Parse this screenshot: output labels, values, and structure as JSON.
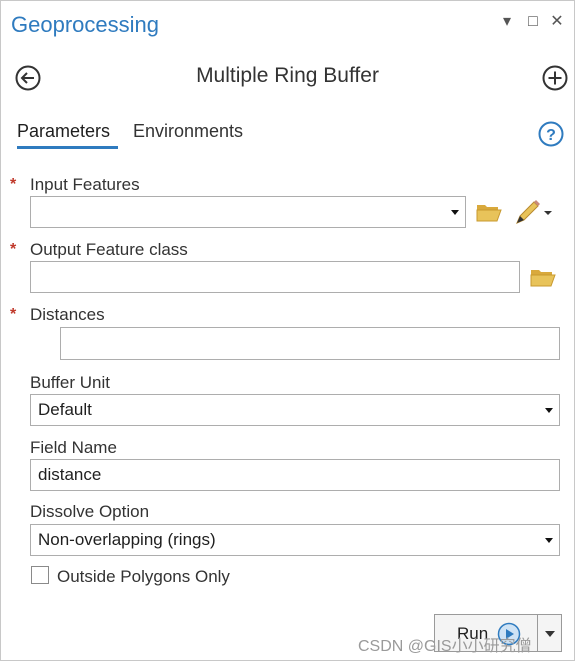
{
  "pane": {
    "title": "Geoprocessing",
    "menu_glyph": "▾",
    "maximize_glyph": "□",
    "close_glyph": "✕"
  },
  "tool": {
    "title": "Multiple Ring Buffer",
    "back_icon": "arrow-left-circle-icon",
    "add_icon": "plus-circle-icon"
  },
  "tabs": [
    {
      "label": "Parameters",
      "active": true
    },
    {
      "label": "Environments",
      "active": false
    }
  ],
  "help_icon": "question-mark-circle-icon",
  "required_marker": "*",
  "params": {
    "input_features": {
      "label": "Input Features",
      "value": "",
      "required": true
    },
    "output_feature_class": {
      "label": "Output Feature class",
      "value": "",
      "required": true
    },
    "distances": {
      "label": "Distances",
      "value": "",
      "required": true
    },
    "buffer_unit": {
      "label": "Buffer Unit",
      "value": "Default"
    },
    "field_name": {
      "label": "Field Name",
      "value": "distance"
    },
    "dissolve_option": {
      "label": "Dissolve Option",
      "value": "Non-overlapping (rings)"
    },
    "outside_polygons_only": {
      "label": "Outside Polygons Only",
      "checked": false
    }
  },
  "run_button": {
    "label": "Run"
  },
  "watermark": "CSDN @GIS小小研究僧",
  "colors": {
    "accent": "#2f7bbf",
    "required": "#c0392b",
    "folder": "#e0b64c"
  }
}
